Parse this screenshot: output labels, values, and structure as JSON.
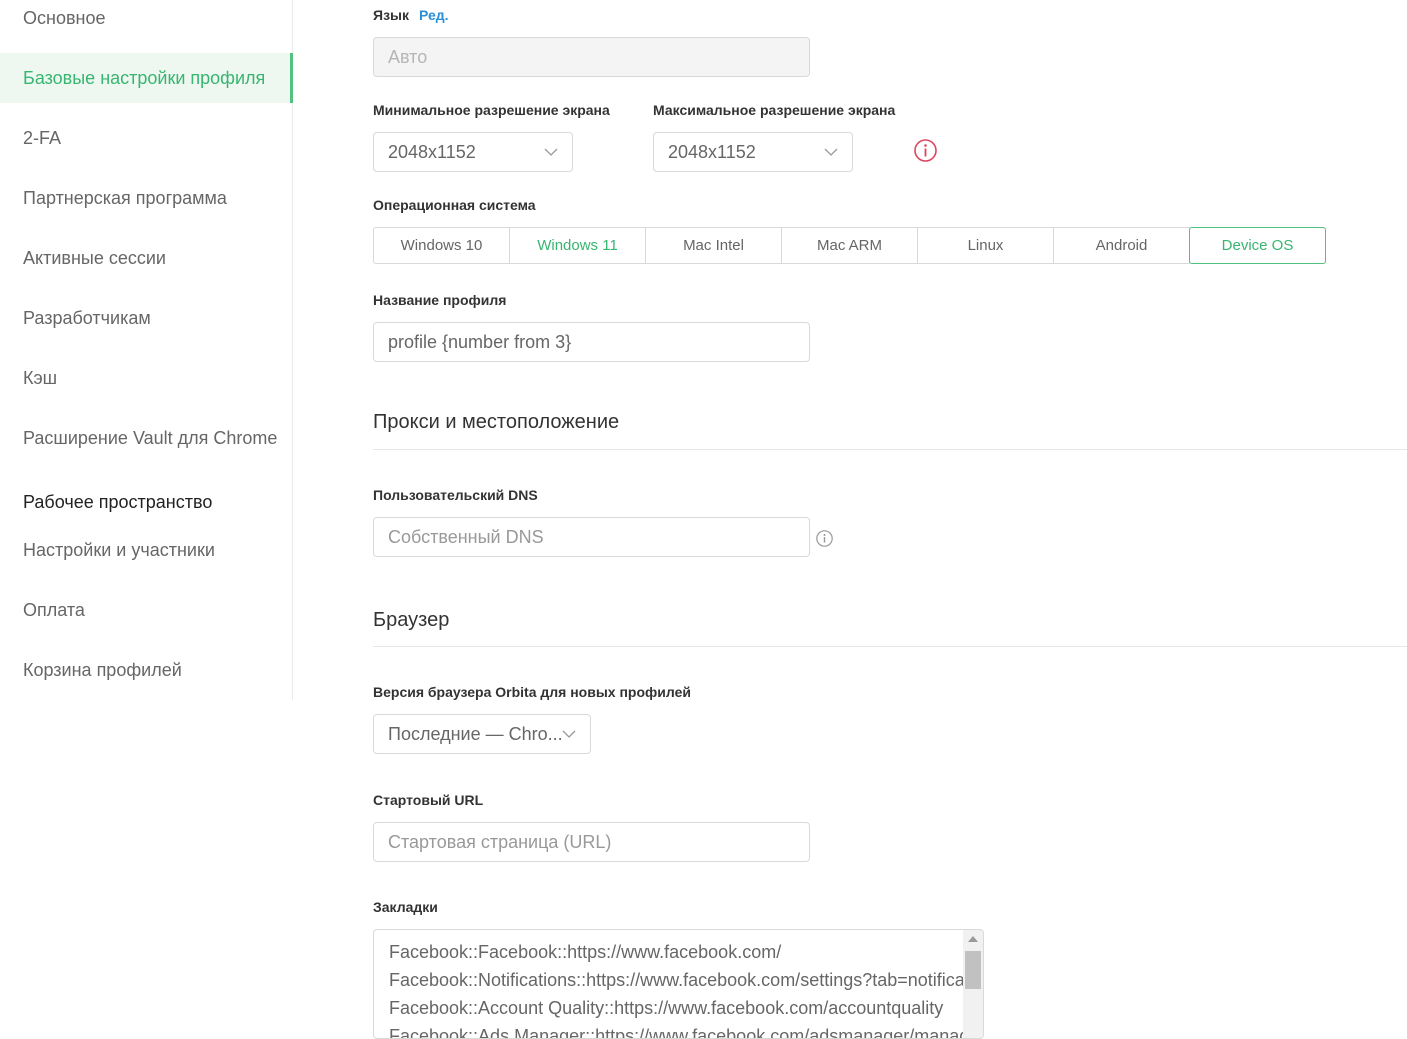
{
  "sidebar": {
    "items": [
      {
        "label": "Основное"
      },
      {
        "label": "Базовые настройки профиля",
        "active": true
      },
      {
        "label": "2-FA"
      },
      {
        "label": "Партнерская программа"
      },
      {
        "label": "Активные сессии"
      },
      {
        "label": "Разработчикам"
      },
      {
        "label": "Кэш"
      },
      {
        "label": "Расширение Vault для Chrome"
      }
    ],
    "workspace_header": "Рабочее пространство",
    "workspace_items": [
      {
        "label": "Настройки и участники"
      },
      {
        "label": "Оплата"
      },
      {
        "label": "Корзина профилей"
      }
    ]
  },
  "form": {
    "language": {
      "label": "Язык",
      "edit_link": "Ред.",
      "value": "Авто"
    },
    "min_resolution": {
      "label": "Минимальное разрешение экрана",
      "value": "2048x1152"
    },
    "max_resolution": {
      "label": "Максимальное разрешение экрана",
      "value": "2048x1152"
    },
    "os": {
      "label": "Операционная система",
      "options": [
        "Windows 10",
        "Windows 11",
        "Mac Intel",
        "Mac ARM",
        "Linux",
        "Android",
        "Device OS"
      ],
      "selected": "Windows 11"
    },
    "profile_name": {
      "label": "Название профиля",
      "value": "profile {number from 3}"
    }
  },
  "proxy_section": {
    "title": "Прокси и местоположение",
    "dns": {
      "label": "Пользовательский DNS",
      "placeholder": "Собственный DNS"
    }
  },
  "browser_section": {
    "title": "Браузер",
    "version": {
      "label": "Версия браузера Orbita для новых профилей",
      "value": "Последние — Chro..."
    },
    "start_url": {
      "label": "Стартовый URL",
      "placeholder": "Стартовая страница (URL)"
    },
    "bookmarks": {
      "label": "Закладки",
      "lines": [
        "Facebook::Facebook::https://www.facebook.com/",
        "Facebook::Notifications::https://www.facebook.com/settings?tab=notifications",
        "Facebook::Account Quality::https://www.facebook.com/accountquality",
        "Facebook::Ads Manager::https://www.facebook.com/adsmanager/manage"
      ]
    }
  },
  "colors": {
    "accent": "#38b570",
    "link": "#2a8fd6",
    "warning": "#e0435f"
  }
}
